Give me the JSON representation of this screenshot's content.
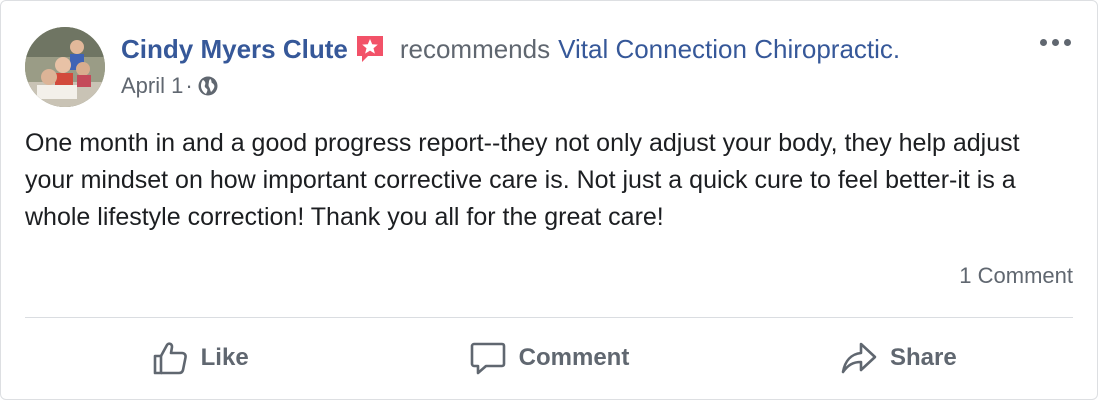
{
  "post": {
    "author": "Cindy Myers Clute",
    "verb": "recommends",
    "page": "Vital Connection Chiropractic.",
    "date": "April 1",
    "date_separator": "·",
    "privacy_icon": "globe-icon",
    "recommendation_icon": "star-bubble-icon",
    "text": "One month in and a good progress report--they not only adjust your body, they help adjust your mindset on how important corrective care is. Not just a quick cure to feel better-it is a whole lifestyle correction! Thank you all for the great care!",
    "comment_count": "1 Comment"
  },
  "actions": {
    "like": "Like",
    "comment": "Comment",
    "share": "Share"
  },
  "colors": {
    "link": "#365899",
    "muted": "#606770",
    "badge": "#f25268",
    "divider": "#dadde1"
  }
}
